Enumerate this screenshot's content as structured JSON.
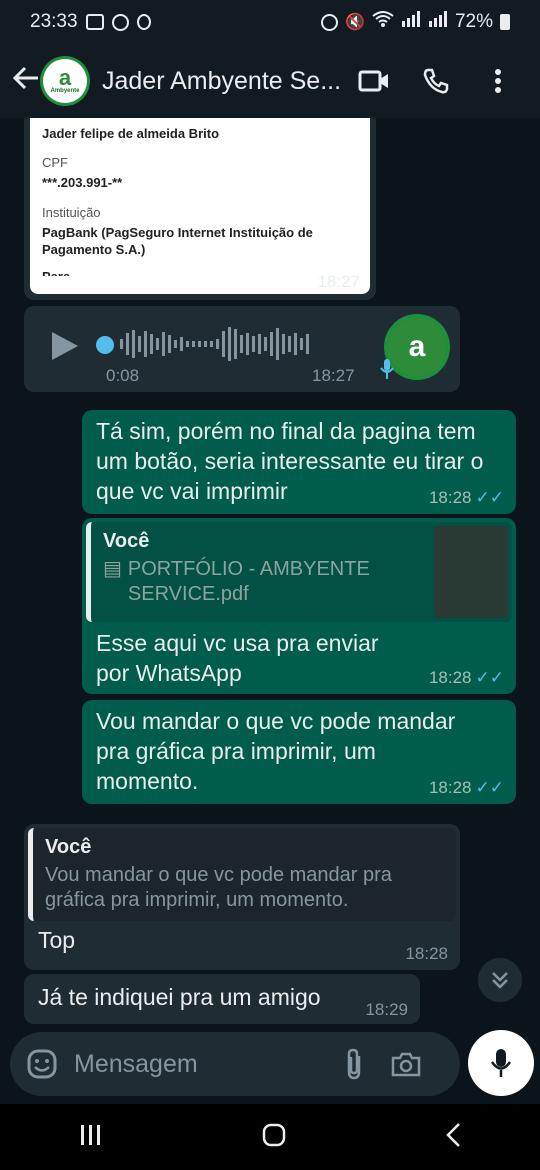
{
  "status": {
    "time": "23:33",
    "battery": "72%"
  },
  "header": {
    "contact_name": "Jader Ambyente Se...",
    "avatar_letter": "a",
    "avatar_brand": "Ambyente"
  },
  "messages": {
    "pix_card": {
      "name": "Jader felipe de almeida Brito",
      "cpf_label": "CPF",
      "cpf_value": "***.203.991-**",
      "inst_label": "Instituição",
      "inst_value": "PagBank (PagSeguro Internet Instituição de Pagamento S.A.)",
      "cut_label": "Para",
      "time": "18:27"
    },
    "audio": {
      "duration": "0:08",
      "time": "18:27"
    },
    "out1": {
      "text": "Tá sim, porém no final da pagina tem um botão, seria interessante eu tirar o que vc vai imprimir",
      "time": "18:28"
    },
    "out2": {
      "quote_author": "Você",
      "quote_file": "PORTFÓLIO - AMBYENTE SERVICE.pdf",
      "text": "Esse aqui vc usa pra enviar por WhatsApp",
      "time": "18:28"
    },
    "out3": {
      "text": "Vou mandar o que vc pode mandar pra gráfica pra imprimir, um momento.",
      "time": "18:28"
    },
    "in1": {
      "quote_author": "Você",
      "quote_text": "Vou mandar o que vc pode mandar pra gráfica pra imprimir, um momento.",
      "text": "Top",
      "time": "18:28"
    },
    "in2": {
      "text": "Já te indiquei pra um amigo",
      "time": "18:29"
    }
  },
  "composer": {
    "placeholder": "Mensagem"
  },
  "colors": {
    "outgoing": "#005c4b",
    "incoming": "#202c33",
    "read_ticks": "#53bdeb"
  }
}
